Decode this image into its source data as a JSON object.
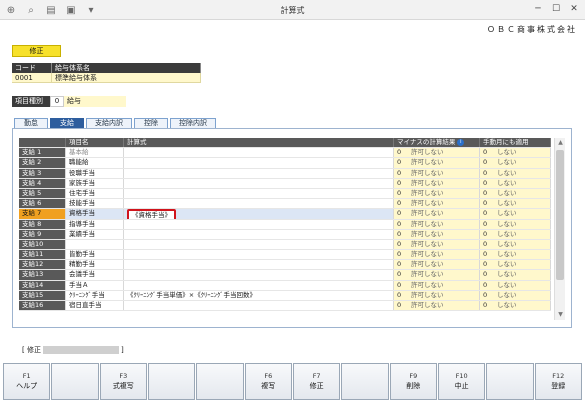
{
  "window": {
    "title": "計算式",
    "company": "ＯＢＣ商事株式会社",
    "toolbar_icons": [
      "add-person-icon",
      "search-icon",
      "print-icon",
      "save-icon",
      "dropdown-icon"
    ]
  },
  "mode": "修正",
  "header_table": {
    "code_header": "コード",
    "name_header": "給与体系名",
    "code": "0001",
    "name": "標準給与体系"
  },
  "item_kind": {
    "label": "項目種別",
    "number": "0",
    "value": "給与"
  },
  "tabs": [
    {
      "label": "勤怠",
      "active": false
    },
    {
      "label": "支給",
      "active": true
    },
    {
      "label": "支給内訳",
      "active": false
    },
    {
      "label": "控除",
      "active": false
    },
    {
      "label": "控除内訳",
      "active": false
    }
  ],
  "grid": {
    "columns": {
      "code": "",
      "name": "項目名",
      "formula": "計算式",
      "minus": "マイナスの計算結果",
      "apply": "手動月にも適用"
    },
    "rows": [
      {
        "code": "支給 1",
        "name": "基本給",
        "formula": "",
        "minus_num": "0",
        "minus": "許可しない",
        "apply_num": "0",
        "apply": "しない",
        "gray": true
      },
      {
        "code": "支給 2",
        "name": "職能給",
        "formula": "",
        "minus_num": "0",
        "minus": "許可しない",
        "apply_num": "0",
        "apply": "しない"
      },
      {
        "code": "支給 3",
        "name": "役職手当",
        "formula": "",
        "minus_num": "0",
        "minus": "許可しない",
        "apply_num": "0",
        "apply": "しない"
      },
      {
        "code": "支給 4",
        "name": "家族手当",
        "formula": "",
        "minus_num": "0",
        "minus": "許可しない",
        "apply_num": "0",
        "apply": "しない"
      },
      {
        "code": "支給 5",
        "name": "住宅手当",
        "formula": "",
        "minus_num": "0",
        "minus": "許可しない",
        "apply_num": "0",
        "apply": "しない"
      },
      {
        "code": "支給 6",
        "name": "技能手当",
        "formula": "",
        "minus_num": "0",
        "minus": "許可しない",
        "apply_num": "0",
        "apply": "しない"
      },
      {
        "code": "支給 7",
        "name": "資格手当",
        "formula": "《資格手当》",
        "minus_num": "0",
        "minus": "許可しない",
        "apply_num": "0",
        "apply": "しない",
        "selected": true
      },
      {
        "code": "支給 8",
        "name": "指導手当",
        "formula": "",
        "minus_num": "0",
        "minus": "許可しない",
        "apply_num": "0",
        "apply": "しない"
      },
      {
        "code": "支給 9",
        "name": "業績手当",
        "formula": "",
        "minus_num": "0",
        "minus": "許可しない",
        "apply_num": "0",
        "apply": "しない"
      },
      {
        "code": "支給10",
        "name": "",
        "formula": "",
        "minus_num": "0",
        "minus": "許可しない",
        "apply_num": "0",
        "apply": "しない"
      },
      {
        "code": "支給11",
        "name": "皆勤手当",
        "formula": "",
        "minus_num": "0",
        "minus": "許可しない",
        "apply_num": "0",
        "apply": "しない"
      },
      {
        "code": "支給12",
        "name": "精勤手当",
        "formula": "",
        "minus_num": "0",
        "minus": "許可しない",
        "apply_num": "0",
        "apply": "しない"
      },
      {
        "code": "支給13",
        "name": "会議手当",
        "formula": "",
        "minus_num": "0",
        "minus": "許可しない",
        "apply_num": "0",
        "apply": "しない"
      },
      {
        "code": "支給14",
        "name": "手当Ａ",
        "formula": "",
        "minus_num": "0",
        "minus": "許可しない",
        "apply_num": "0",
        "apply": "しない"
      },
      {
        "code": "支給15",
        "name": "ｸﾘｰﾆﾝｸﾞ手当",
        "formula": "《ｸﾘｰﾆﾝｸﾞ手当単価》×《ｸﾘｰﾆﾝｸﾞ手当回数》",
        "minus_num": "0",
        "minus": "許可しない",
        "apply_num": "0",
        "apply": "しない"
      },
      {
        "code": "支給16",
        "name": "宿日直手当",
        "formula": "",
        "minus_num": "0",
        "minus": "許可しない",
        "apply_num": "0",
        "apply": "しない"
      }
    ]
  },
  "status": {
    "open": "[ 修正",
    "close": "]"
  },
  "function_keys": [
    {
      "key": "F1",
      "name": "ヘルプ"
    },
    {
      "key": "",
      "name": ""
    },
    {
      "key": "F3",
      "name": "式複写"
    },
    {
      "key": "",
      "name": ""
    },
    {
      "key": "",
      "name": ""
    },
    {
      "key": "F6",
      "name": "複写"
    },
    {
      "key": "F7",
      "name": "修正"
    },
    {
      "key": "",
      "name": ""
    },
    {
      "key": "F9",
      "name": "削除"
    },
    {
      "key": "F10",
      "name": "中止"
    },
    {
      "key": "",
      "name": ""
    },
    {
      "key": "F12",
      "name": "登録"
    }
  ],
  "colors": {
    "selected_code": "#f0a020",
    "highlight_border": "#d0141c",
    "mode_badge": "#f7e12b",
    "active_tab": "#2e5e9e"
  }
}
